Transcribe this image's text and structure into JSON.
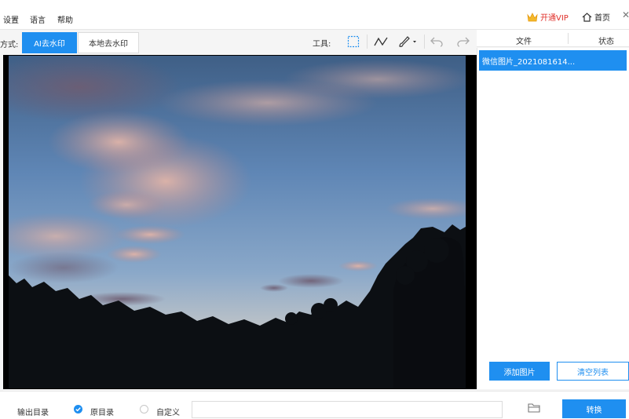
{
  "menu": {
    "settings": "设置",
    "language": "语言",
    "help": "帮助"
  },
  "header": {
    "vip_label": "开通VIP",
    "home_label": "首页"
  },
  "mode": {
    "label": "方式:",
    "ai": "AI去水印",
    "local": "本地去水印"
  },
  "tools": {
    "label": "工具:"
  },
  "panel": {
    "col_file": "文件",
    "col_status": "状态",
    "file_name": "微信图片_2021081614...",
    "add_button": "添加图片",
    "clear_button": "清空列表"
  },
  "bottom": {
    "output_label": "输出目录",
    "option_original": "原目录",
    "option_custom": "自定义",
    "path_value": "",
    "convert_button": "转换"
  },
  "colors": {
    "accent": "#1f8ff0",
    "vip": "#e0302a"
  },
  "icons": {
    "rect_select": "rect-select-icon",
    "line": "line-icon",
    "brush": "brush-icon",
    "undo": "undo-icon",
    "redo": "redo-icon",
    "crown": "crown-icon",
    "home": "home-icon",
    "folder": "folder-icon"
  }
}
